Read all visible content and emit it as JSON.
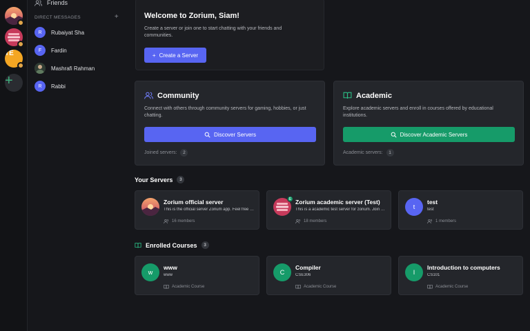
{
  "rail": {
    "servers": [
      {
        "name": "zorium-official",
        "type": "sunset"
      },
      {
        "name": "zorium-academic",
        "type": "stack"
      },
      {
        "name": "test-education",
        "initials": "TE"
      },
      {
        "name": "add-server",
        "glyph": "+"
      }
    ],
    "accent_badge": "#e0a54a"
  },
  "dm": {
    "friends_label": "Friends",
    "section_title": "DIRECT MESSAGES",
    "add_glyph": "+",
    "users": [
      {
        "initial": "R",
        "name": "Rubaiyat Sha"
      },
      {
        "initial": "F",
        "name": "Fardin"
      },
      {
        "initial": "",
        "name": "Mashrafi Rahman"
      },
      {
        "initial": "R",
        "name": "Rabbi"
      }
    ]
  },
  "welcome": {
    "title": "Welcome to Zorium, Siam!",
    "text": "Create a server or join one to start chatting with your friends and communities.",
    "create_button": "Create a Server"
  },
  "community": {
    "title": "Community",
    "text": "Connect with others through community servers for gaming, hobbies, or just chatting.",
    "button": "Discover Servers",
    "joined_label": "Joined servers:",
    "joined_count": "2"
  },
  "academic": {
    "title": "Academic",
    "text": "Explore academic servers and enroll in courses offered by educational institutions.",
    "button": "Discover Academic Servers",
    "servers_label": "Academic servers:",
    "servers_count": "1"
  },
  "your_servers": {
    "title": "Your Servers",
    "count": "3",
    "items": [
      {
        "name": "Zorium official server",
        "desc": "This is the official server Zorium app. Feel free to join",
        "members": "16 members",
        "avatar": "sunset"
      },
      {
        "name": "Zorium academic server (Test)",
        "desc": "This is a academic test server for zorium. Join now",
        "members": "18 members",
        "avatar": "stack",
        "badge": "E"
      },
      {
        "name": "test",
        "desc": "test",
        "members": "1 members",
        "avatar_letter": "t",
        "avatar_color": "#5865f2"
      }
    ]
  },
  "enrolled": {
    "title": "Enrolled Courses",
    "count": "3",
    "items": [
      {
        "letter": "w",
        "name": "www",
        "code": "www",
        "type": "Academic Course"
      },
      {
        "letter": "C",
        "name": "Compiler",
        "code": "CSE306",
        "type": "Academic Course"
      },
      {
        "letter": "I",
        "name": "Introduction to computers",
        "code": "CS101",
        "type": "Academic Course"
      }
    ],
    "color": "#169b69"
  },
  "colors": {
    "primary": "#5865f2",
    "academic_green": "#169b69"
  }
}
